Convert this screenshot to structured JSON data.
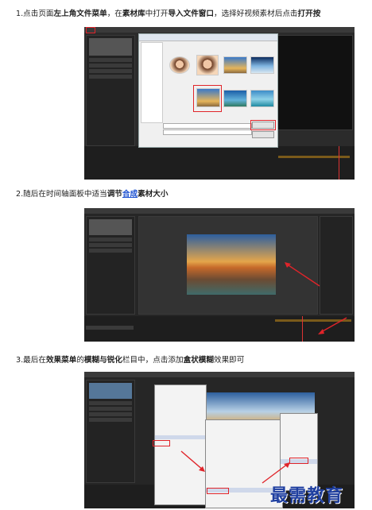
{
  "steps": [
    {
      "parts": [
        {
          "text": "1.点击页面",
          "bold": false
        },
        {
          "text": "左上角文件菜单",
          "bold": true
        },
        {
          "text": "，在",
          "bold": false
        },
        {
          "text": "素材库",
          "bold": true
        },
        {
          "text": "中打开",
          "bold": false
        },
        {
          "text": "导入文件窗口",
          "bold": true
        },
        {
          "text": "，选择好视频素材后点击",
          "bold": false
        },
        {
          "text": "打开按",
          "bold": true
        }
      ]
    },
    {
      "parts": [
        {
          "text": "2.随后在",
          "bold": false
        },
        {
          "text": "时间轴面板",
          "bold": false
        },
        {
          "text": "中适当",
          "bold": false
        },
        {
          "text": "调节",
          "bold": true
        },
        {
          "text": "合成",
          "bold": true,
          "link": true
        },
        {
          "text": "素材大小",
          "bold": true
        }
      ]
    },
    {
      "parts": [
        {
          "text": "3.最后在",
          "bold": false
        },
        {
          "text": "效果菜单",
          "bold": true
        },
        {
          "text": "的",
          "bold": false
        },
        {
          "text": "模糊与锐化",
          "bold": true
        },
        {
          "text": "栏目中，点击添加",
          "bold": false
        },
        {
          "text": "盒状模糊",
          "bold": true
        },
        {
          "text": "效果即可",
          "bold": false
        }
      ]
    }
  ],
  "brand": "最需教育",
  "colors": {
    "highlight_red": "#e0242a",
    "link_blue": "#1a4fd0",
    "brand_blue": "#1f3fa0"
  }
}
